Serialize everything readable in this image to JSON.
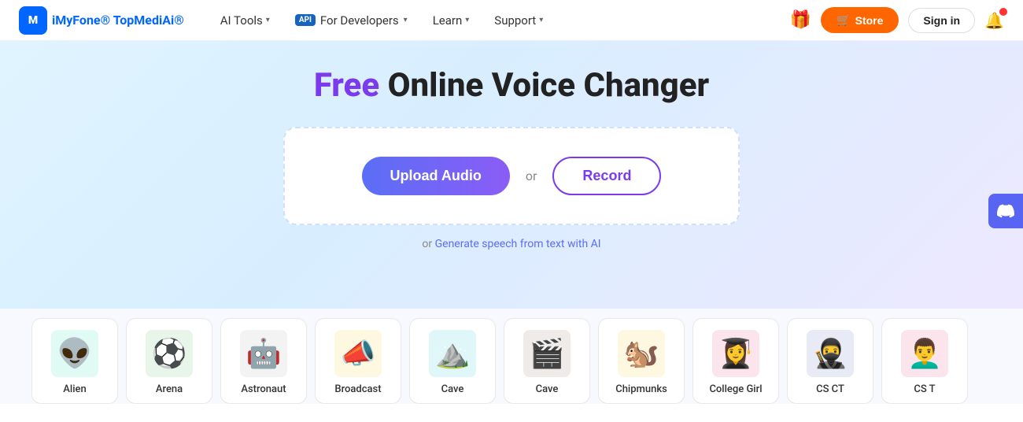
{
  "navbar": {
    "logo_icon": "M",
    "logo_brand": "iMyFone",
    "logo_product": "TopMediAi",
    "logo_trademark": "®",
    "nav_items": [
      {
        "id": "ai-tools",
        "label": "AI Tools",
        "has_chevron": true,
        "is_api": false
      },
      {
        "id": "for-developers",
        "label": "For Developers",
        "has_chevron": true,
        "is_api": true
      },
      {
        "id": "learn",
        "label": "Learn",
        "has_chevron": true,
        "is_api": false
      },
      {
        "id": "support",
        "label": "Support",
        "has_chevron": true,
        "is_api": false
      }
    ],
    "store_label": "Store",
    "signin_label": "Sign in"
  },
  "hero": {
    "title_free": "Free",
    "title_rest": " Online Voice Changer",
    "upload_label": "Upload Audio",
    "or_label": "or",
    "record_label": "Record",
    "generate_prefix": "or ",
    "generate_link_text": "Generate speech from text with AI"
  },
  "voices": [
    {
      "id": "alien",
      "label": "Alien",
      "icon": "👽",
      "icon_class": "icon-alien"
    },
    {
      "id": "arena",
      "label": "Arena",
      "icon": "⚽",
      "icon_class": "icon-arena"
    },
    {
      "id": "astronaut",
      "label": "Astronaut",
      "icon": "🤖",
      "icon_class": "icon-astronaut"
    },
    {
      "id": "broadcast",
      "label": "Broadcast",
      "icon": "📣",
      "icon_class": "icon-broadcast"
    },
    {
      "id": "cave1",
      "label": "Cave",
      "icon": "⛰️",
      "icon_class": "icon-cave1"
    },
    {
      "id": "cave2",
      "label": "Cave",
      "icon": "🎬",
      "icon_class": "icon-cave2"
    },
    {
      "id": "chipmunks",
      "label": "Chipmunks",
      "icon": "🐿️",
      "icon_class": "icon-chipmunks"
    },
    {
      "id": "college-girl",
      "label": "College Girl",
      "icon": "👩‍🎓",
      "icon_class": "icon-college"
    },
    {
      "id": "csct",
      "label": "CS CT",
      "icon": "🥷",
      "icon_class": "icon-csct"
    },
    {
      "id": "cst",
      "label": "CS T",
      "icon": "👨‍🦱",
      "icon_class": "icon-cst"
    }
  ],
  "discord": {
    "label": "Discord"
  }
}
